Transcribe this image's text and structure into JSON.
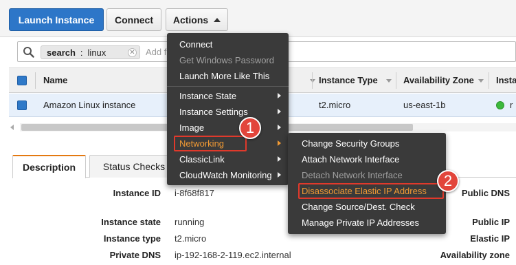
{
  "toolbar": {
    "launch_label": "Launch Instance",
    "connect_label": "Connect",
    "actions_label": "Actions"
  },
  "search": {
    "token_key": "search",
    "token_sep": ":",
    "token_value": "linux",
    "placeholder": "Add filter"
  },
  "table": {
    "columns": [
      "Name",
      "Instance Type",
      "Availability Zone",
      "Insta"
    ],
    "row": {
      "name": "Amazon Linux instance",
      "type": "t2.micro",
      "zone": "us-east-1b",
      "state_initial": "r"
    }
  },
  "tabs": [
    "Description",
    "Status Checks"
  ],
  "details": {
    "instance_id_label": "Instance ID",
    "instance_id_value": "i-8f68f817",
    "state_label": "Instance state",
    "state_value": "running",
    "type_label": "Instance type",
    "type_value": "t2.micro",
    "dns_label": "Private DNS",
    "dns_value": "ip-192-168-2-119.ec2.internal",
    "public_dns_label": "Public DNS",
    "public_ip_label": "Public IP",
    "elastic_ip_label": "Elastic IP",
    "availability_zone_label": "Availability zone"
  },
  "actions_menu": {
    "items": [
      {
        "label": "Connect",
        "disabled": false
      },
      {
        "label": "Get Windows Password",
        "disabled": true
      },
      {
        "label": "Launch More Like This",
        "disabled": false
      },
      {
        "label": "Instance State",
        "submenu": true
      },
      {
        "label": "Instance Settings",
        "submenu": true
      },
      {
        "label": "Image",
        "submenu": true
      },
      {
        "label": "Networking",
        "submenu": true,
        "highlighted": true
      },
      {
        "label": "ClassicLink",
        "submenu": true
      },
      {
        "label": "CloudWatch Monitoring",
        "submenu": true
      }
    ]
  },
  "networking_menu": {
    "items": [
      {
        "label": "Change Security Groups",
        "disabled": false
      },
      {
        "label": "Attach Network Interface",
        "disabled": false
      },
      {
        "label": "Detach Network Interface",
        "disabled": true
      },
      {
        "label": "Disassociate Elastic IP Address",
        "highlighted": true
      },
      {
        "label": "Change Source/Dest. Check",
        "disabled": false
      },
      {
        "label": "Manage Private IP Addresses",
        "disabled": false
      }
    ]
  },
  "steps": [
    "1",
    "2"
  ],
  "colors": {
    "primary": "#2d76c8",
    "menu_bg": "#3a3a3a",
    "highlight": "#f19a34",
    "callout": "#e2453b",
    "running": "#3cb93c"
  },
  "icons": [
    "search-icon",
    "close-icon",
    "chevron-up-icon",
    "chevron-right-icon",
    "sort-caret-icon"
  ]
}
